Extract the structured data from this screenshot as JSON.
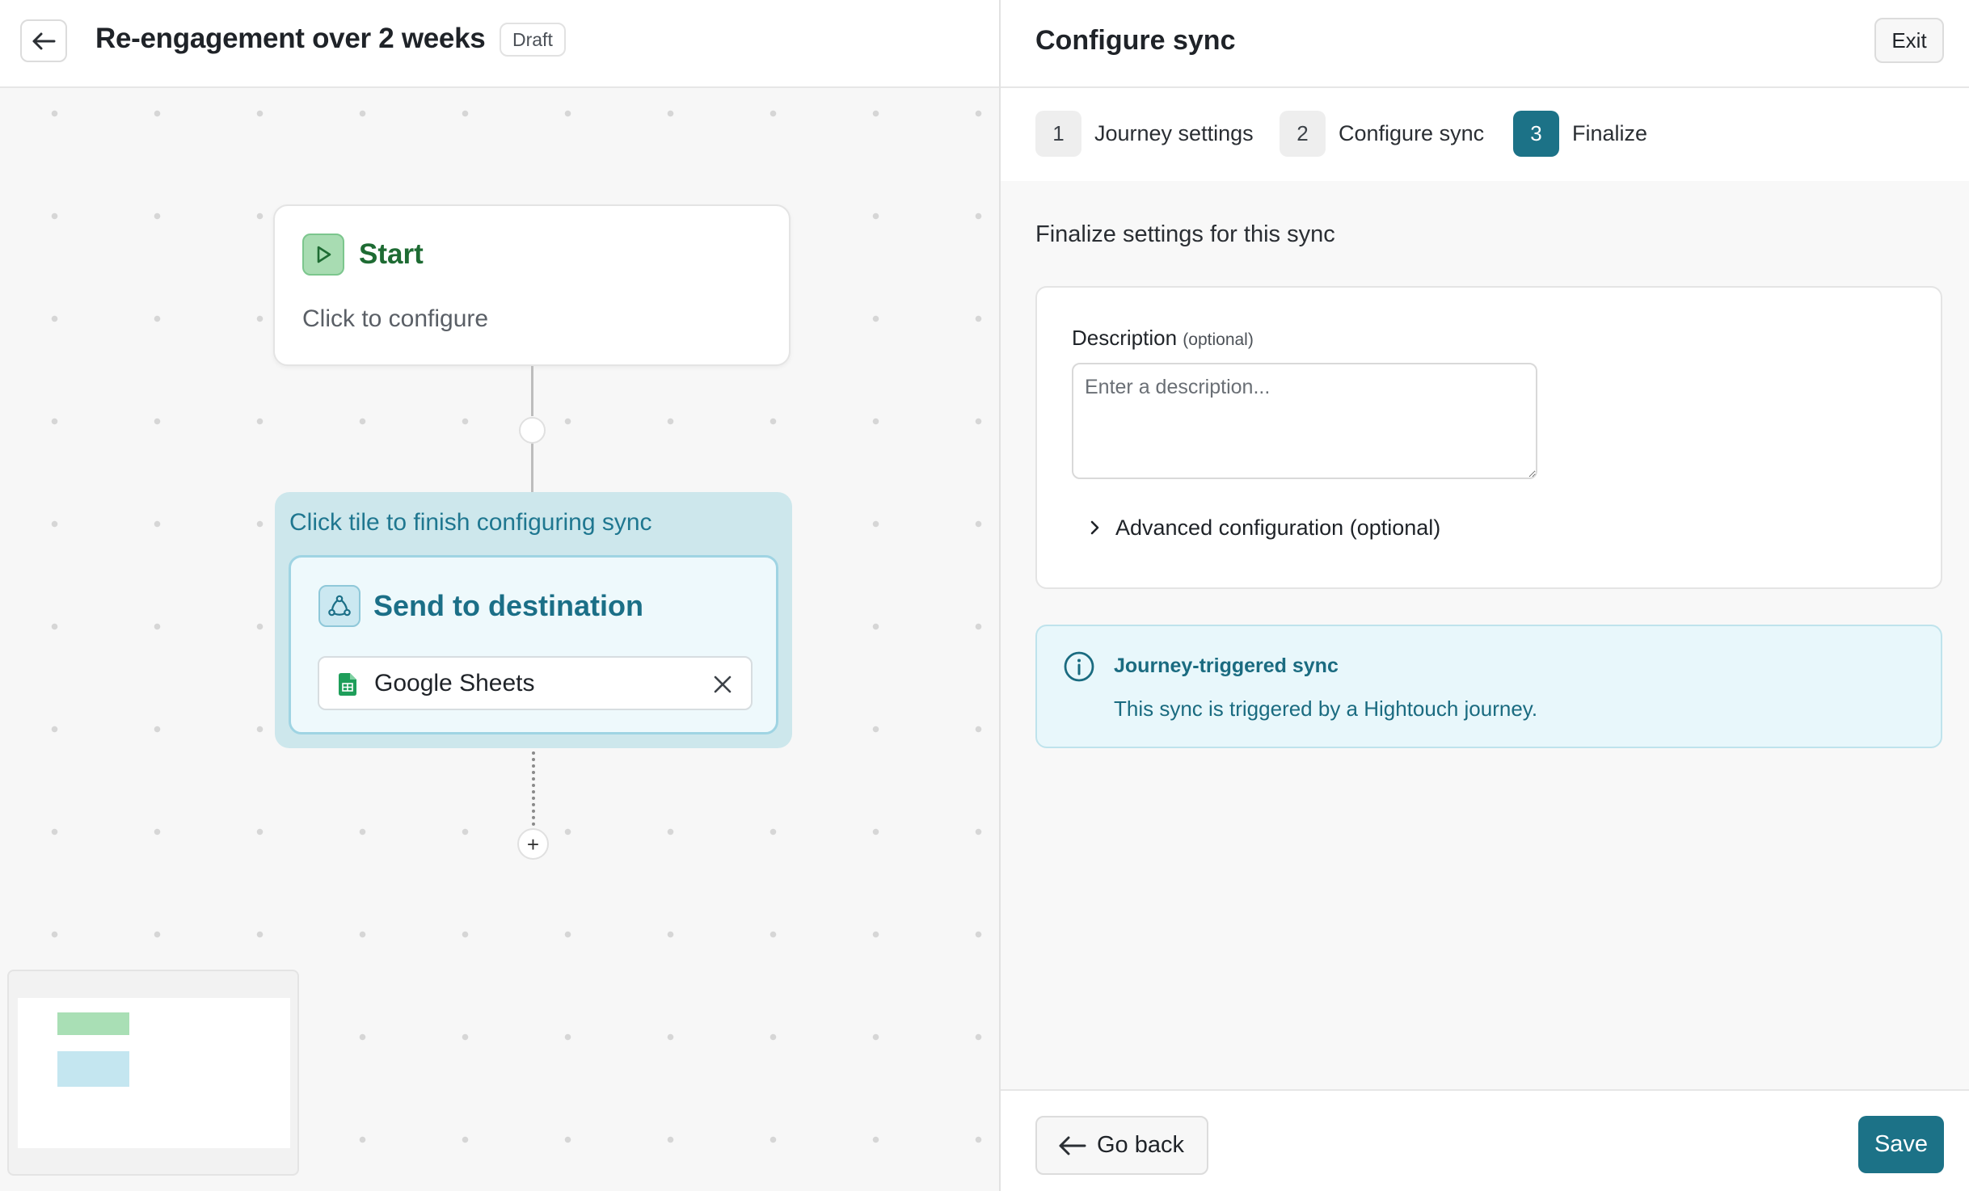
{
  "journey": {
    "title": "Re-engagement over 2 weeks",
    "status_badge": "Draft"
  },
  "canvas": {
    "start_node": {
      "title": "Start",
      "subtitle": "Click to configure",
      "icon": "play-icon"
    },
    "sync_group": {
      "label": "Click tile to finish configuring sync",
      "card_title": "Send to destination",
      "card_icon": "destination-icon",
      "destination": {
        "name": "Google Sheets",
        "icon": "google-sheets-icon"
      }
    },
    "add_step_symbol": "+"
  },
  "panel": {
    "title": "Configure sync",
    "exit_label": "Exit",
    "steps": [
      {
        "number": "1",
        "label": "Journey settings",
        "active": false
      },
      {
        "number": "2",
        "label": "Configure sync",
        "active": false
      },
      {
        "number": "3",
        "label": "Finalize",
        "active": true
      }
    ],
    "heading": "Finalize settings for this sync",
    "description": {
      "label": "Description",
      "optional_hint": "(optional)",
      "placeholder": "Enter a description...",
      "value": ""
    },
    "advanced_label": "Advanced configuration (optional)",
    "info": {
      "title": "Journey-triggered sync",
      "text": "This sync is triggered by a Hightouch journey."
    },
    "go_back_label": "Go back",
    "save_label": "Save"
  },
  "colors": {
    "accent": "#1c7287",
    "start_green": "#1e6b33",
    "sync_teal": "#1b6f87",
    "info_bg": "#e8f7fb"
  }
}
